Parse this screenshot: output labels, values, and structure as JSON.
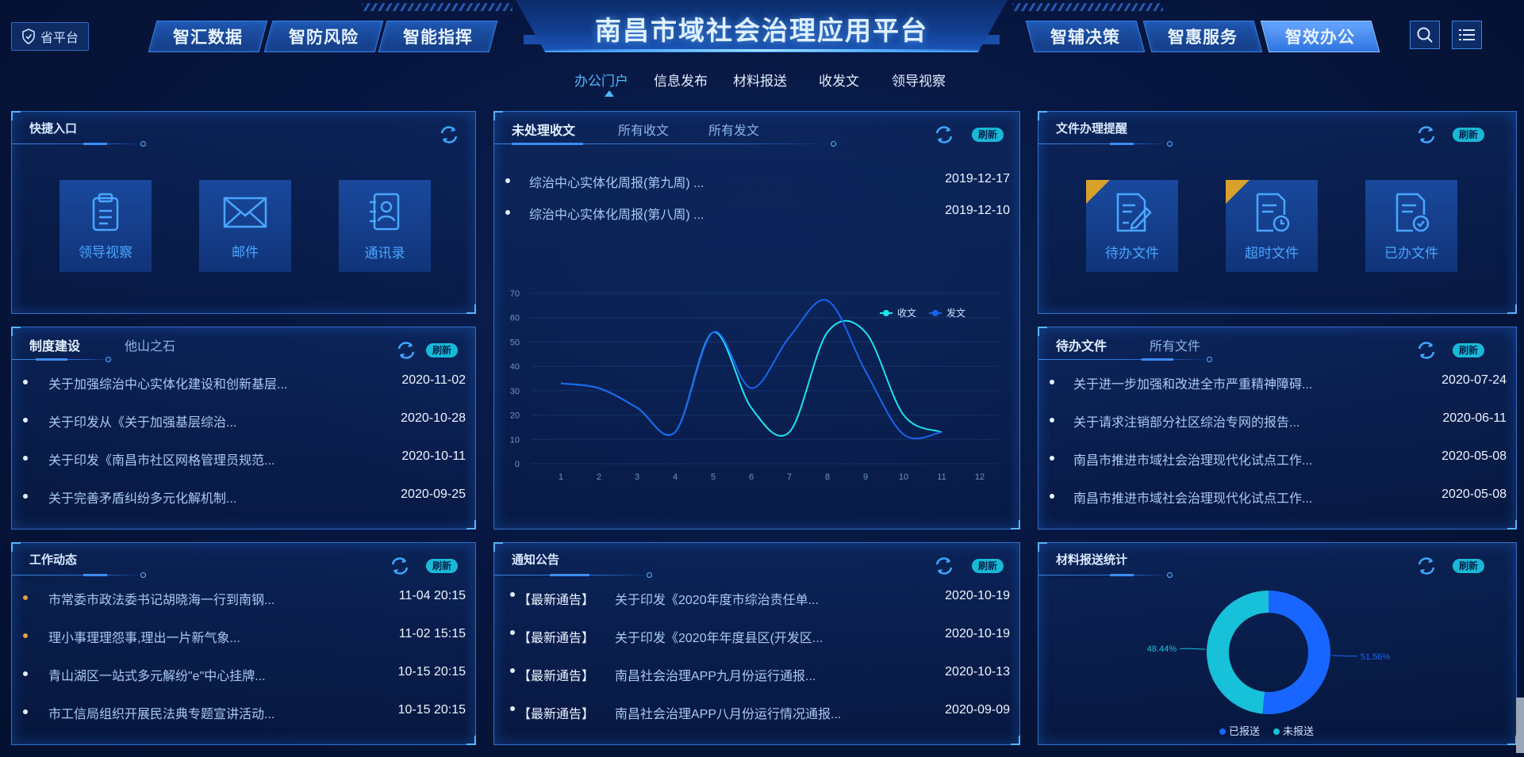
{
  "header": {
    "prov_label": "省平台",
    "title": "南昌市域社会治理应用平台",
    "left_nav": [
      "智汇数据",
      "智防风险",
      "智能指挥"
    ],
    "right_nav": [
      "智辅决策",
      "智惠服务",
      "智效办公"
    ],
    "active_nav": "智效办公",
    "icons": [
      "search-icon",
      "menu-list-icon"
    ]
  },
  "subnav": {
    "items": [
      "办公门户",
      "信息发布",
      "材料报送",
      "收发文",
      "领导视察"
    ],
    "active": "办公门户"
  },
  "refresh_label": "刷新",
  "quick_entry": {
    "title": "快捷入口",
    "tiles": [
      {
        "label": "领导视察",
        "icon": "clipboard-icon"
      },
      {
        "label": "邮件",
        "icon": "envelope-icon"
      },
      {
        "label": "通讯录",
        "icon": "contacts-icon"
      }
    ]
  },
  "incoming": {
    "tabs": [
      "未处理收文",
      "所有收文",
      "所有发文"
    ],
    "rows": [
      {
        "text": "综治中心实体化周报(第九周) ...",
        "date": "2019-12-17"
      },
      {
        "text": "综治中心实体化周报(第八周) ...",
        "date": "2019-12-10"
      }
    ]
  },
  "doc_reminder": {
    "title": "文件办理提醒",
    "tiles": [
      {
        "label": "待办文件",
        "icon": "edit-document-icon",
        "flag": true
      },
      {
        "label": "超时文件",
        "icon": "clock-document-icon",
        "flag": true
      },
      {
        "label": "已办文件",
        "icon": "check-document-icon",
        "flag": false
      }
    ]
  },
  "system": {
    "tabs": [
      "制度建设",
      "他山之石"
    ],
    "rows": [
      {
        "text": "关于加强综治中心实体化建设和创新基层...",
        "date": "2020-11-02"
      },
      {
        "text": "关于印发从《关于加强基层综治...",
        "date": "2020-10-28"
      },
      {
        "text": "关于印发《南昌市社区网格管理员规范...",
        "date": "2020-10-11"
      },
      {
        "text": "关于完善矛盾纠纷多元化解机制...",
        "date": "2020-09-25"
      }
    ]
  },
  "pending": {
    "tabs": [
      "待办文件",
      "所有文件"
    ],
    "rows": [
      {
        "text": "关于进一步加强和改进全市严重精神障碍...",
        "date": "2020-07-24"
      },
      {
        "text": "关于请求注销部分社区综治专网的报告...",
        "date": "2020-06-11"
      },
      {
        "text": "南昌市推进市域社会治理现代化试点工作...",
        "date": "2020-05-08"
      },
      {
        "text": "南昌市推进市域社会治理现代化试点工作...",
        "date": "2020-05-08"
      }
    ]
  },
  "work_news": {
    "title": "工作动态",
    "rows": [
      {
        "text": "市常委市政法委书记胡晓海一行到南钢...",
        "date": "11-04 20:15",
        "accent": true
      },
      {
        "text": "理小事理理怨事,理出一片新气象...",
        "date": "11-02 15:15",
        "accent": true
      },
      {
        "text": "青山湖区一站式多元解纷\"e\"中心挂牌...",
        "date": "10-15 20:15",
        "accent": false
      },
      {
        "text": "市工信局组织开展民法典专题宣讲活动...",
        "date": "10-15 20:15",
        "accent": false
      }
    ]
  },
  "notices": {
    "title": "通知公告",
    "rows": [
      {
        "tag": "【最新通告】",
        "text": "关于印发《2020年度市综治责任单...",
        "date": "2020-10-19"
      },
      {
        "tag": "【最新通告】",
        "text": "关于印发《2020年年度县区(开发区...",
        "date": "2020-10-19"
      },
      {
        "tag": "【最新通告】",
        "text": "南昌社会治理APP九月份运行通报...",
        "date": "2020-10-13"
      },
      {
        "tag": "【最新通告】",
        "text": "南昌社会治理APP八月份运行情况通报...",
        "date": "2020-09-09"
      }
    ]
  },
  "material_stats": {
    "title": "材料报送统计"
  },
  "colors": {
    "accent": "#4fb8ff",
    "receive": "#1ee3f0",
    "send": "#1a63f0",
    "submitted": "#1866ff",
    "unsubmitted": "#17c1d9"
  },
  "chart_data": [
    {
      "type": "line",
      "x": [
        1,
        2,
        3,
        4,
        5,
        6,
        7,
        8,
        9,
        10,
        11,
        12
      ],
      "ylim": [
        0,
        70
      ],
      "yticks": [
        0,
        10,
        20,
        30,
        40,
        50,
        60,
        70
      ],
      "series": [
        {
          "name": "收文",
          "values": [
            33,
            31,
            23,
            13,
            54,
            23,
            13,
            54,
            54,
            20,
            13
          ]
        },
        {
          "name": "发文",
          "values": [
            33,
            31,
            23,
            13,
            54,
            31,
            52,
            67,
            38,
            12,
            13
          ]
        }
      ],
      "legend_position": "top-right",
      "grid": true
    },
    {
      "type": "pie",
      "donut": true,
      "slices": [
        {
          "name": "已报送",
          "value": 51.56,
          "label": "51.56%"
        },
        {
          "name": "未报送",
          "value": 48.44,
          "label": "48.44%"
        }
      ],
      "legend_position": "bottom"
    }
  ]
}
